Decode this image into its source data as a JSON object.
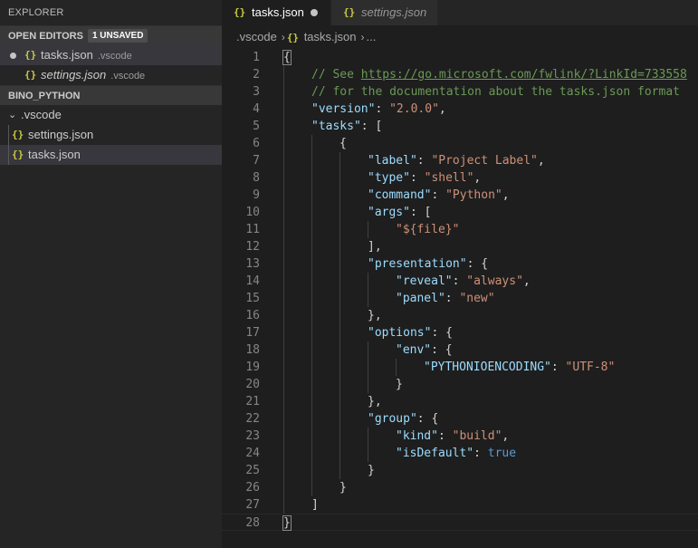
{
  "sidebar": {
    "title": "EXPLORER",
    "open_editors": {
      "label": "OPEN EDITORS",
      "badge": "1 UNSAVED",
      "items": [
        {
          "icon": "{}",
          "name": "tasks.json",
          "desc": ".vscode",
          "unsaved": true
        },
        {
          "icon": "{}",
          "name": "settings.json",
          "desc": ".vscode",
          "italic": true
        }
      ]
    },
    "project": {
      "label": "BINO_PYTHON",
      "folder": ".vscode",
      "files": [
        "settings.json",
        "tasks.json"
      ]
    }
  },
  "tabs": [
    {
      "icon": "{}",
      "label": "tasks.json"
    },
    {
      "icon": "{}",
      "label": "settings.json"
    }
  ],
  "breadcrumb": {
    "folder": ".vscode",
    "icon": "{}",
    "file": "tasks.json",
    "tail": "..."
  },
  "editor": {
    "lines": [
      {
        "n": "1",
        "indent": 0,
        "parts": [
          [
            "brace",
            "{"
          ]
        ]
      },
      {
        "n": "2",
        "indent": 1,
        "parts": [
          [
            "com",
            "// See "
          ],
          [
            "link",
            "https://go.microsoft.com/fwlink/?LinkId=733558"
          ]
        ]
      },
      {
        "n": "3",
        "indent": 1,
        "parts": [
          [
            "com",
            "// for the documentation about the tasks.json format"
          ]
        ]
      },
      {
        "n": "4",
        "indent": 1,
        "parts": [
          [
            "key",
            "\"version\""
          ],
          [
            "punc",
            ": "
          ],
          [
            "str",
            "\"2.0.0\""
          ],
          [
            "punc",
            ","
          ]
        ]
      },
      {
        "n": "5",
        "indent": 1,
        "parts": [
          [
            "key",
            "\"tasks\""
          ],
          [
            "punc",
            ": ["
          ]
        ]
      },
      {
        "n": "6",
        "indent": 2,
        "parts": [
          [
            "punc",
            "{"
          ]
        ]
      },
      {
        "n": "7",
        "indent": 3,
        "parts": [
          [
            "key",
            "\"label\""
          ],
          [
            "punc",
            ": "
          ],
          [
            "str",
            "\"Project Label\""
          ],
          [
            "punc",
            ","
          ]
        ]
      },
      {
        "n": "8",
        "indent": 3,
        "parts": [
          [
            "key",
            "\"type\""
          ],
          [
            "punc",
            ": "
          ],
          [
            "str",
            "\"shell\""
          ],
          [
            "punc",
            ","
          ]
        ]
      },
      {
        "n": "9",
        "indent": 3,
        "parts": [
          [
            "key",
            "\"command\""
          ],
          [
            "punc",
            ": "
          ],
          [
            "str",
            "\"Python\""
          ],
          [
            "punc",
            ","
          ]
        ]
      },
      {
        "n": "10",
        "indent": 3,
        "parts": [
          [
            "key",
            "\"args\""
          ],
          [
            "punc",
            ": ["
          ]
        ]
      },
      {
        "n": "11",
        "indent": 4,
        "parts": [
          [
            "str",
            "\"${file}\""
          ]
        ]
      },
      {
        "n": "12",
        "indent": 3,
        "parts": [
          [
            "punc",
            "],"
          ]
        ]
      },
      {
        "n": "13",
        "indent": 3,
        "parts": [
          [
            "key",
            "\"presentation\""
          ],
          [
            "punc",
            ": {"
          ]
        ]
      },
      {
        "n": "14",
        "indent": 4,
        "parts": [
          [
            "key",
            "\"reveal\""
          ],
          [
            "punc",
            ": "
          ],
          [
            "str",
            "\"always\""
          ],
          [
            "punc",
            ","
          ]
        ]
      },
      {
        "n": "15",
        "indent": 4,
        "parts": [
          [
            "key",
            "\"panel\""
          ],
          [
            "punc",
            ": "
          ],
          [
            "str",
            "\"new\""
          ]
        ]
      },
      {
        "n": "16",
        "indent": 3,
        "parts": [
          [
            "punc",
            "},"
          ]
        ]
      },
      {
        "n": "17",
        "indent": 3,
        "parts": [
          [
            "key",
            "\"options\""
          ],
          [
            "punc",
            ": {"
          ]
        ]
      },
      {
        "n": "18",
        "indent": 4,
        "parts": [
          [
            "key",
            "\"env\""
          ],
          [
            "punc",
            ": {"
          ]
        ]
      },
      {
        "n": "19",
        "indent": 5,
        "parts": [
          [
            "key",
            "\"PYTHONIOENCODING\""
          ],
          [
            "punc",
            ": "
          ],
          [
            "str",
            "\"UTF-8\""
          ]
        ]
      },
      {
        "n": "20",
        "indent": 4,
        "parts": [
          [
            "punc",
            "}"
          ]
        ]
      },
      {
        "n": "21",
        "indent": 3,
        "parts": [
          [
            "punc",
            "},"
          ]
        ]
      },
      {
        "n": "22",
        "indent": 3,
        "parts": [
          [
            "key",
            "\"group\""
          ],
          [
            "punc",
            ": {"
          ]
        ]
      },
      {
        "n": "23",
        "indent": 4,
        "parts": [
          [
            "key",
            "\"kind\""
          ],
          [
            "punc",
            ": "
          ],
          [
            "str",
            "\"build\""
          ],
          [
            "punc",
            ","
          ]
        ]
      },
      {
        "n": "24",
        "indent": 4,
        "parts": [
          [
            "key",
            "\"isDefault\""
          ],
          [
            "punc",
            ": "
          ],
          [
            "bool",
            "true"
          ]
        ]
      },
      {
        "n": "25",
        "indent": 3,
        "parts": [
          [
            "punc",
            "}"
          ]
        ]
      },
      {
        "n": "26",
        "indent": 2,
        "parts": [
          [
            "punc",
            "}"
          ]
        ]
      },
      {
        "n": "27",
        "indent": 1,
        "parts": [
          [
            "punc",
            "]"
          ]
        ]
      },
      {
        "n": "28",
        "indent": 0,
        "parts": [
          [
            "brace",
            "}"
          ]
        ]
      }
    ]
  },
  "colors": {
    "json_icon": "#cbcb41",
    "key": "#9cdcfe",
    "string": "#ce9178",
    "comment": "#6a9955",
    "bool": "#569cd6"
  }
}
